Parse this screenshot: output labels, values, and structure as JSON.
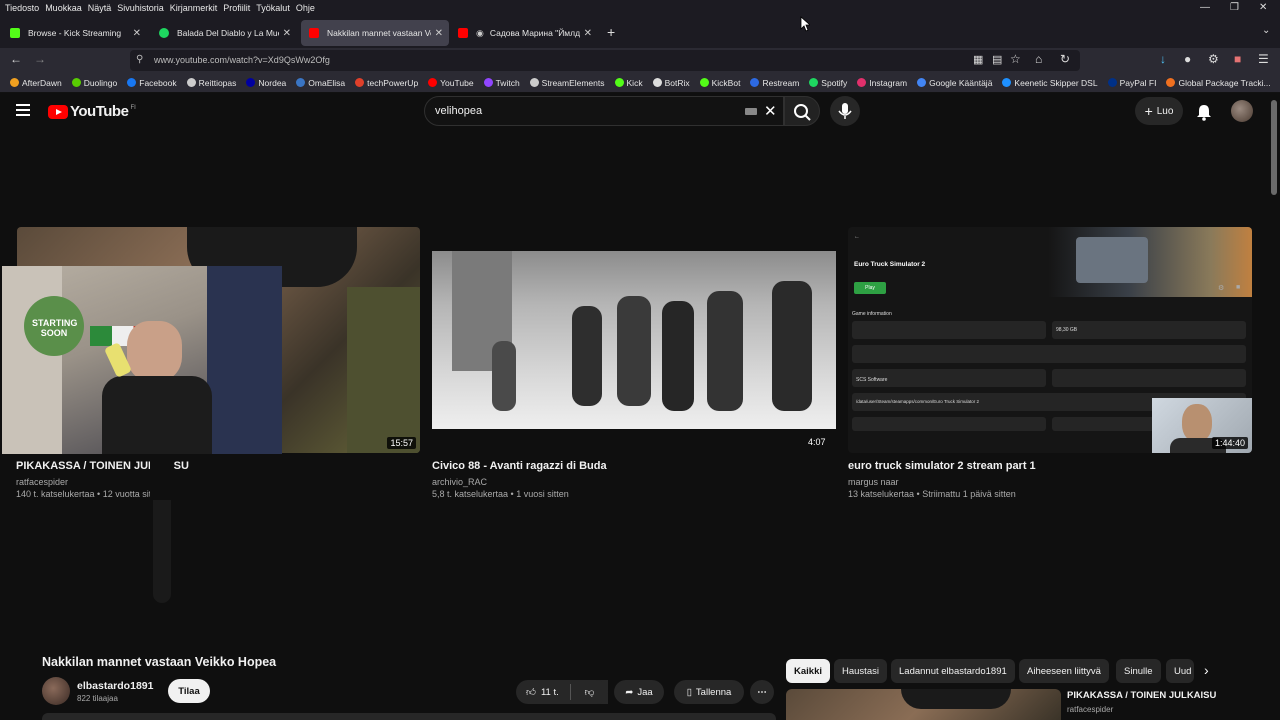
{
  "menubar": {
    "items": [
      "Tiedosto",
      "Muokkaa",
      "Näytä",
      "Sivuhistoria",
      "Kirjanmerkit",
      "Profiilit",
      "Työkalut",
      "Ohje"
    ]
  },
  "tabs": [
    {
      "label": "Browse - Kick Streaming",
      "favicon_color": "#53fc18"
    },
    {
      "label": "Balada Del Diablo y La Muerte -",
      "favicon_color": "#1ed760"
    },
    {
      "label": "Nakkilan mannet vastaan Veikk",
      "favicon_color": "#ff0000"
    },
    {
      "label": "Садова Марина \"Ймлдыр",
      "favicon_color": "#ff0000"
    }
  ],
  "nav": {
    "url": "www.youtube.com/watch?v=Xd9QsWw2Ofg"
  },
  "bookmarks": [
    {
      "label": "AfterDawn",
      "color": "#f0a020"
    },
    {
      "label": "Duolingo",
      "color": "#58cc02"
    },
    {
      "label": "Facebook",
      "color": "#1877f2"
    },
    {
      "label": "Reittiopas",
      "color": "#cccccc"
    },
    {
      "label": "Nordea",
      "color": "#0000a0"
    },
    {
      "label": "OmaElisa",
      "color": "#3a75c4"
    },
    {
      "label": "techPowerUp",
      "color": "#e0402a"
    },
    {
      "label": "YouTube",
      "color": "#ff0000"
    },
    {
      "label": "Twitch",
      "color": "#9146ff"
    },
    {
      "label": "StreamElements",
      "color": "#cccccc"
    },
    {
      "label": "Kick",
      "color": "#53fc18"
    },
    {
      "label": "BotRix",
      "color": "#dddddd"
    },
    {
      "label": "KickBot",
      "color": "#53fc18"
    },
    {
      "label": "Restream",
      "color": "#2d6ae3"
    },
    {
      "label": "Spotify",
      "color": "#1ed760"
    },
    {
      "label": "Instagram",
      "color": "#e1306c"
    },
    {
      "label": "Google Kääntäjä",
      "color": "#4285f4"
    },
    {
      "label": "Keenetic Skipper DSL",
      "color": "#1e90ff"
    },
    {
      "label": "PayPal FI",
      "color": "#003087"
    },
    {
      "label": "Global Package Tracki...",
      "color": "#f07020"
    }
  ],
  "youtube": {
    "logo_text": "YouTube",
    "region": "FI",
    "search_value": "velihopea",
    "create_label": "Luo"
  },
  "videos": [
    {
      "title": "PIKAKASSA / TOINEN JULKAISU",
      "channel": "ratfacespider",
      "meta": "140 t. katselukertaa • 12 vuotta sitten",
      "duration": "15:57"
    },
    {
      "title": "Civico 88 - Avanti ragazzi di Buda",
      "channel": "archivio_RAC",
      "meta": "5,8 t. katselukertaa • 1 vuosi sitten",
      "duration": "4:07"
    },
    {
      "title": "euro truck simulator 2 stream part 1",
      "channel": "margus naar",
      "meta": "13 katselukertaa • Striimattu 1 päivä sitten",
      "duration": "1:44:40"
    }
  ],
  "overlay": {
    "sign_text": "STARTING SOON"
  },
  "ets_thumb": {
    "heading": "Euro Truck Simulator 2",
    "play": "Play",
    "section": "Game information",
    "size": "98,30 GB",
    "developer": "SCS Software",
    "path": "/data/user/Steam/steamapps/common/Euro Truck Simulator 2"
  },
  "watch": {
    "title": "Nakkilan mannet vastaan Veikko Hopea",
    "channel": "elbastardo1891",
    "subscribers": "822 tilaajaa",
    "subscribe_label": "Tilaa",
    "likes": "11 t.",
    "share_label": "Jaa",
    "save_label": "Tallenna"
  },
  "chips": [
    "Kaikki",
    "Haustasi",
    "Ladannut elbastardo1891",
    "Aiheeseen liittyvä",
    "Sinulle",
    "Uud"
  ],
  "upnext": {
    "title": "PIKAKASSA / TOINEN JULKAISU",
    "channel": "ratfacespider"
  }
}
